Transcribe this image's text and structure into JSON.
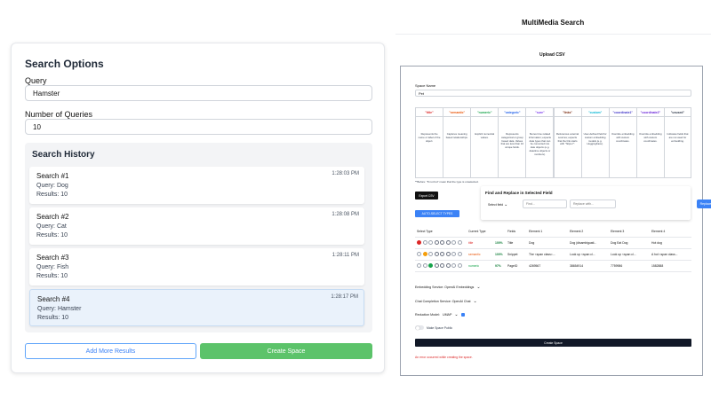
{
  "left": {
    "title": "Search Options",
    "query_label": "Query",
    "query_value": "Hamster",
    "num_label": "Number of Queries",
    "num_value": "10",
    "history": {
      "title": "Search History",
      "items": [
        {
          "title": "Search #1",
          "query": "Query: Dog",
          "results": "Results: 10",
          "time": "1:28:03 PM"
        },
        {
          "title": "Search #2",
          "query": "Query: Cat",
          "results": "Results: 10",
          "time": "1:28:08 PM"
        },
        {
          "title": "Search #3",
          "query": "Query: Fish",
          "results": "Results: 10",
          "time": "1:28:11 PM"
        },
        {
          "title": "Search #4",
          "query": "Query: Hamster",
          "results": "Results: 10",
          "time": "1:28:17 PM"
        }
      ]
    },
    "add_more_label": "Add More Results",
    "create_space_label": "Create Space"
  },
  "right": {
    "app_title": "MultiMedia Search",
    "upload_label": "Upload CSV",
    "space_name_label": "Space Name",
    "space_name_value": "Pet",
    "types": [
      {
        "name": "\"title\"",
        "color": "#dc2626",
        "desc": "Represents the name or label of the object."
      },
      {
        "name": "\"semantic\"",
        "color": "#ea580c",
        "desc": "Captures meaning based relationships."
      },
      {
        "name": "\"numeric\"",
        "color": "#16a34a",
        "desc": "Explicit numerical values."
      },
      {
        "name": "\"categoric\"",
        "color": "#2563eb",
        "desc": "Represents categorical or group based data. Values that are less than 10 unique fields."
      },
      {
        "name": "\"sure\"",
        "color": "#7c3aed",
        "desc": "Stores time related information; expects data types that can be converted into date objects (e.g. datetime objects or numbers)."
      },
      {
        "name": "\"links\"",
        "color": "#7c2d12",
        "desc": "References external sources; expects that the link starts with \"https://\"."
      },
      {
        "name": "\"custom\"",
        "color": "#06b6d4",
        "desc": "User-defined field for custom embedding models (e.g. HuggingFace)."
      },
      {
        "name": "\"coordinate1\"",
        "color": "#4338ca",
        "desc": "Override embedding with custom coordinates."
      },
      {
        "name": "\"coordinate2\"",
        "color": "#6d28d9",
        "desc": "Override embedding with custom coordinates."
      },
      {
        "name": "\"unused\"",
        "color": "#374151",
        "desc": "Indicates fields that are not used for embedding."
      }
    ],
    "types_note": "**Before: \"8 not but\" mean that the type is unselected.",
    "export_label": "Export CSV",
    "auto_label": "AUTO-SELECT TYPES",
    "find_replace": {
      "title": "Find and Replace in Selected Field",
      "select_field": "Select field",
      "find_placeholder": "Find...",
      "replace_placeholder": "Replace with...",
      "replace_button": "Replace"
    },
    "table": {
      "headers": [
        "Select Type",
        "Current Type",
        "",
        "Fields",
        "Element 1",
        "Element 2",
        "Element 3",
        "Element 4"
      ],
      "rows": [
        {
          "type": "title",
          "type_color": "#dc2626",
          "pct": "100%",
          "field": "Title",
          "e1": "Dog",
          "e2": "Dog (disambiguati...",
          "e3": "Dog Eat Dog",
          "e4": "Hot dog"
        },
        {
          "type": "semantic",
          "type_color": "#ea580c",
          "pct": "100%",
          "field": "Snippet",
          "e1": "The <span class=...",
          "e2": "Look up <span cl...",
          "e3": "Look up <span cl...",
          "e4": "A hot <span class..."
        },
        {
          "type": "numeric",
          "type_color": "#16a34a",
          "pct": "97%",
          "field": "PageID",
          "e1": "4269567",
          "e2": "38654914",
          "e3": "7759986",
          "e4": "1582888"
        }
      ]
    },
    "embedding_label": "Embedding Service: OpenAI Embeddings",
    "chat_label": "Chat Completion Service: OpenAI Chat",
    "reduction_label": "Reduction Model:",
    "reduction_value": "UMAP",
    "make_public_label": "Make Space Public",
    "create_label": "Create Space",
    "error": "An error occurred while creating the space."
  }
}
